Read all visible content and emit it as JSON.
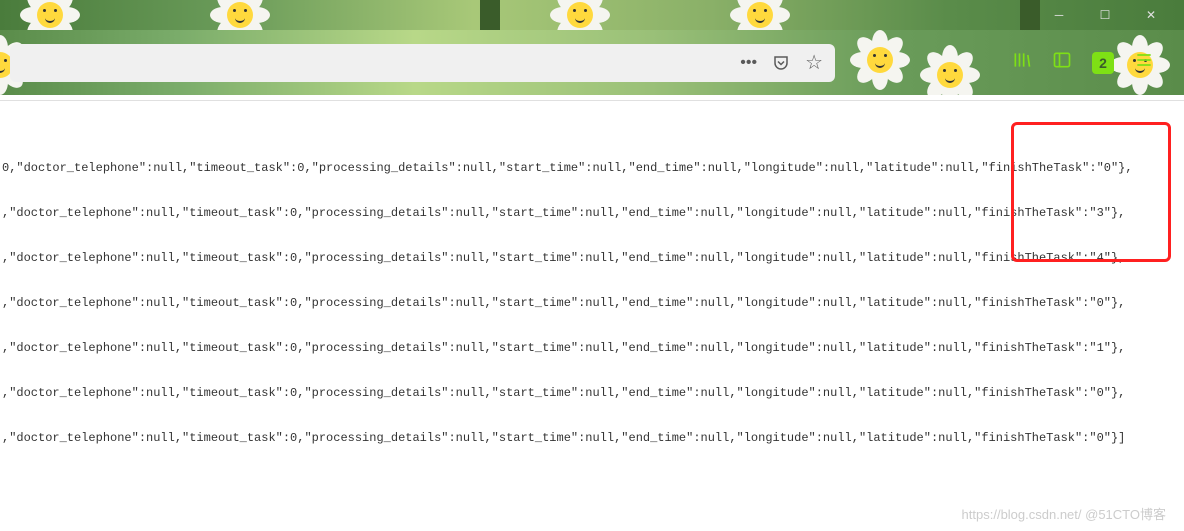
{
  "window": {
    "minimize": "─",
    "maximize": "☐",
    "close": "✕"
  },
  "browser": {
    "more_icon": "•••",
    "pocket_icon": "pocket",
    "star_icon": "☆"
  },
  "json_lines": [
    "0,\"doctor_telephone\":null,\"timeout_task\":0,\"processing_details\":null,\"start_time\":null,\"end_time\":null,\"longitude\":null,\"latitude\":null,\"finishTheTask\":\"0\"},",
    ",\"doctor_telephone\":null,\"timeout_task\":0,\"processing_details\":null,\"start_time\":null,\"end_time\":null,\"longitude\":null,\"latitude\":null,\"finishTheTask\":\"3\"},",
    ",\"doctor_telephone\":null,\"timeout_task\":0,\"processing_details\":null,\"start_time\":null,\"end_time\":null,\"longitude\":null,\"latitude\":null,\"finishTheTask\":\"4\"},",
    ",\"doctor_telephone\":null,\"timeout_task\":0,\"processing_details\":null,\"start_time\":null,\"end_time\":null,\"longitude\":null,\"latitude\":null,\"finishTheTask\":\"0\"},",
    ",\"doctor_telephone\":null,\"timeout_task\":0,\"processing_details\":null,\"start_time\":null,\"end_time\":null,\"longitude\":null,\"latitude\":null,\"finishTheTask\":\"1\"},",
    ",\"doctor_telephone\":null,\"timeout_task\":0,\"processing_details\":null,\"start_time\":null,\"end_time\":null,\"longitude\":null,\"latitude\":null,\"finishTheTask\":\"0\"},",
    ",\"doctor_telephone\":null,\"timeout_task\":0,\"processing_details\":null,\"start_time\":null,\"end_time\":null,\"longitude\":null,\"latitude\":null,\"finishTheTask\":\"0\"}]"
  ],
  "watermark": "https://blog.csdn.net/  @51CTO博客"
}
